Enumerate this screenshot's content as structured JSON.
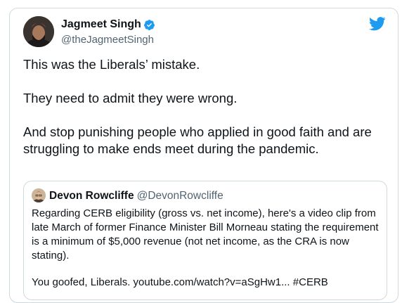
{
  "tweet": {
    "author": {
      "name": "Jagmeet Singh",
      "handle": "@theJagmeetSingh",
      "verified": true
    },
    "paragraphs": [
      "This was the Liberals’ mistake.",
      "They need to admit they were wrong.",
      "And stop punishing people who applied in good faith and are struggling to make ends meet during the pandemic."
    ],
    "quoted": {
      "author": {
        "name": "Devon Rowcliffe",
        "handle": "@DevonRowcliffe"
      },
      "paragraphs": [
        "Regarding CERB eligibility (gross vs. net income), here's a video clip from late March of former Finance Minister Bill Morneau stating the requirement is a minimum of $5,000 revenue (not net income, as the CRA is now stating).",
        "You goofed, Liberals. youtube.com/watch?v=aSgHw1... #CERB"
      ]
    }
  },
  "icons": {
    "verified": "verified-badge-icon",
    "brand": "twitter-bird-icon"
  },
  "colors": {
    "brand_blue": "#1d9bf0",
    "secondary_text": "#536471",
    "border": "#cfd9de"
  }
}
